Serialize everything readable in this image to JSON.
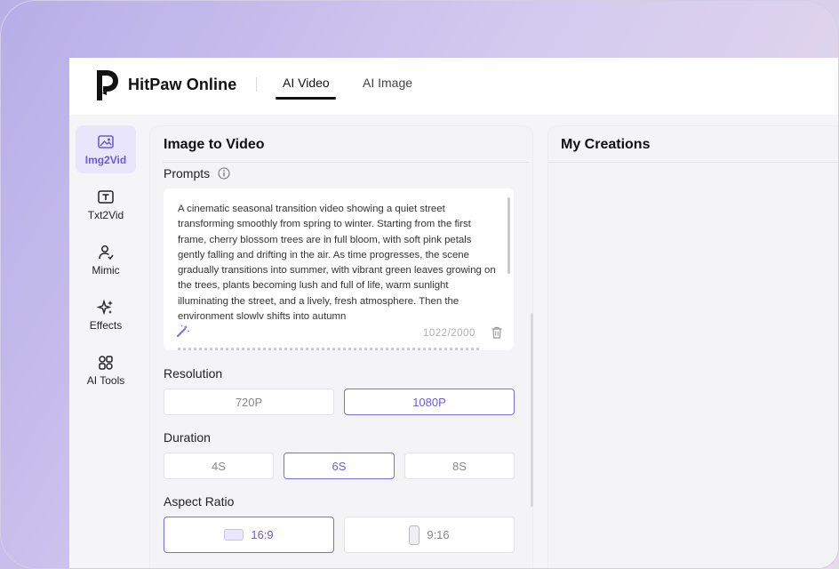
{
  "brand": {
    "name": "HitPaw Online"
  },
  "nav_tabs": [
    {
      "label": "AI Video",
      "active": true
    },
    {
      "label": "AI Image",
      "active": false
    }
  ],
  "sidebar": {
    "items": [
      {
        "label": "Img2Vid",
        "icon": "image-icon",
        "active": true
      },
      {
        "label": "Txt2Vid",
        "icon": "text-icon",
        "active": false
      },
      {
        "label": "Mimic",
        "icon": "person-icon",
        "active": false
      },
      {
        "label": "Effects",
        "icon": "sparkle-icon",
        "active": false
      },
      {
        "label": "AI Tools",
        "icon": "grid-icon",
        "active": false
      }
    ]
  },
  "panel": {
    "title": "Image to Video",
    "prompts_label": "Prompts",
    "prompt_text": "A cinematic seasonal transition video showing a quiet street transforming smoothly from spring to winter. Starting from the first frame, cherry blossom trees are in full bloom, with soft pink petals gently falling and drifting in the air. As time progresses, the scene gradually transitions into summer, with vibrant green leaves growing on the trees, plants becoming lush and full of life, warm sunlight illuminating the street, and a lively, fresh atmosphere. Then the environment slowly shifts into autumn",
    "char_count": "1022/2000",
    "resolution": {
      "label": "Resolution",
      "options": [
        "720P",
        "1080P"
      ],
      "selected": "1080P"
    },
    "duration": {
      "label": "Duration",
      "options": [
        "4S",
        "6S",
        "8S"
      ],
      "selected": "6S"
    },
    "aspect_ratio": {
      "label": "Aspect Ratio",
      "options": [
        "16:9",
        "9:16"
      ],
      "selected": "16:9"
    }
  },
  "creations": {
    "title": "My Creations"
  },
  "colors": {
    "accent": "#6b5bd6",
    "accent_bg": "#e9e5fb"
  }
}
